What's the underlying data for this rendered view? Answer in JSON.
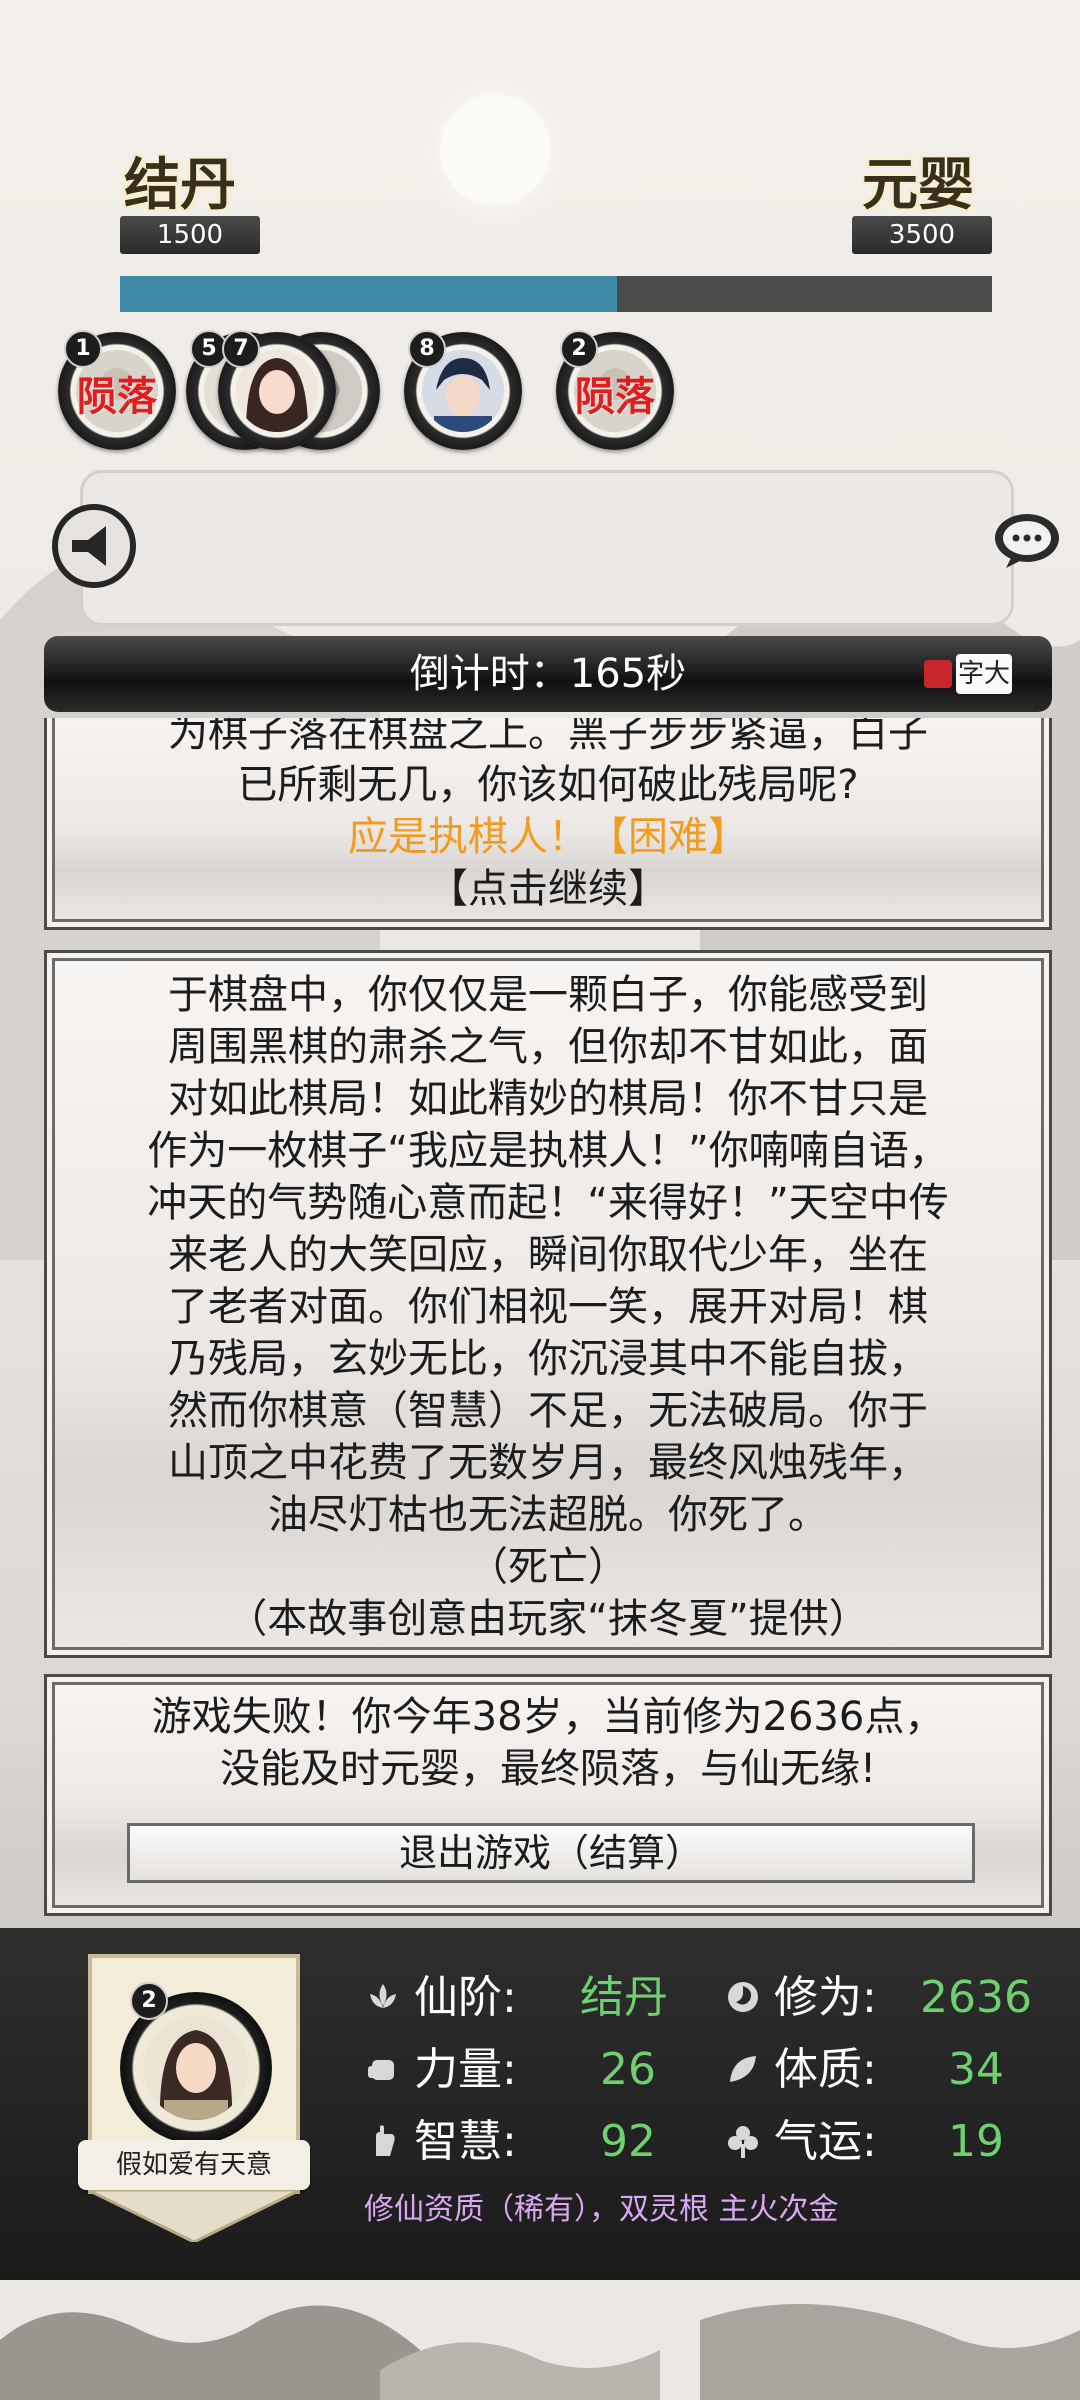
{
  "header": {
    "current_realm": "结丹",
    "current_realm_value": "1500",
    "next_realm": "元婴",
    "next_realm_value": "3500",
    "progress": 0.57
  },
  "tokens": [
    {
      "badge": "1",
      "status": "陨落"
    },
    {
      "badge": "5"
    },
    {
      "badge": "7"
    },
    {
      "badge": "8"
    },
    {
      "badge": "2",
      "status": "陨落"
    }
  ],
  "message_box": {
    "text": ""
  },
  "countdown": {
    "text": "倒计时：165秒",
    "font_toggle": "字大"
  },
  "story_prev": {
    "line1": "为棋子落在棋盘之上。黑子步步紧逼，白子",
    "line2": "已所剩无几，你该如何破此残局呢?",
    "choice": "应是执棋人！【困难】",
    "continue": "【点击继续】"
  },
  "story_main": {
    "lines": [
      "于棋盘中，你仅仅是一颗白子，你能感受到",
      "周围黑棋的肃杀之气，但你却不甘如此，面",
      "对如此棋局！如此精妙的棋局！你不甘只是",
      "作为一枚棋子“我应是执棋人！”你喃喃自语，",
      "冲天的气势随心意而起！“来得好！”天空中传",
      "来老人的大笑回应，瞬间你取代少年，坐在",
      "了老者对面。你们相视一笑，展开对局！棋",
      "乃残局，玄妙无比，你沉浸其中不能自拔，",
      "然而你棋意（智慧）不足，无法破局。你于",
      "山顶之中花费了无数岁月，最终风烛残年，",
      "油尽灯枯也无法超脱。你死了。",
      "（死亡）",
      "（本故事创意由玩家“抹冬夏”提供）"
    ]
  },
  "result": {
    "line1": "游戏失败！你今年38岁，当前修为2636点，",
    "line2": "没能及时元婴，最终陨落，与仙无缘!",
    "exit_button": "退出游戏（结算）"
  },
  "player": {
    "badge": "2",
    "name": "假如爱有天意",
    "stats": {
      "realm_label": "仙阶:",
      "realm_value": "结丹",
      "cultivation_label": "修为:",
      "cultivation_value": "2636",
      "strength_label": "力量:",
      "strength_value": "26",
      "constitution_label": "体质:",
      "constitution_value": "34",
      "wisdom_label": "智慧:",
      "wisdom_value": "92",
      "luck_label": "气运:",
      "luck_value": "19"
    },
    "aptitude": "修仙资质（稀有），双灵根 主火次金"
  },
  "colors": {
    "progress_fill": "#3e8aa6",
    "stat_value": "#6fd06f",
    "choice_highlight": "#f29b1e",
    "fallen_text": "#e21d1d",
    "aptitude_text": "#d9a8f2"
  }
}
